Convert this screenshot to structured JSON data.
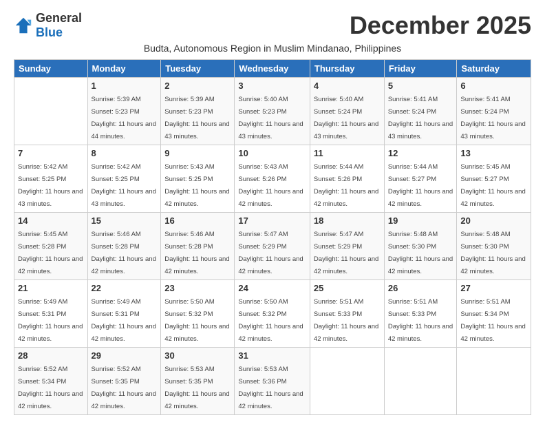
{
  "logo": {
    "general": "General",
    "blue": "Blue"
  },
  "title": "December 2025",
  "subtitle": "Budta, Autonomous Region in Muslim Mindanao, Philippines",
  "headers": [
    "Sunday",
    "Monday",
    "Tuesday",
    "Wednesday",
    "Thursday",
    "Friday",
    "Saturday"
  ],
  "weeks": [
    [
      {
        "day": "",
        "sunrise": "",
        "sunset": "",
        "daylight": ""
      },
      {
        "day": "1",
        "sunrise": "Sunrise: 5:39 AM",
        "sunset": "Sunset: 5:23 PM",
        "daylight": "Daylight: 11 hours and 44 minutes."
      },
      {
        "day": "2",
        "sunrise": "Sunrise: 5:39 AM",
        "sunset": "Sunset: 5:23 PM",
        "daylight": "Daylight: 11 hours and 43 minutes."
      },
      {
        "day": "3",
        "sunrise": "Sunrise: 5:40 AM",
        "sunset": "Sunset: 5:23 PM",
        "daylight": "Daylight: 11 hours and 43 minutes."
      },
      {
        "day": "4",
        "sunrise": "Sunrise: 5:40 AM",
        "sunset": "Sunset: 5:24 PM",
        "daylight": "Daylight: 11 hours and 43 minutes."
      },
      {
        "day": "5",
        "sunrise": "Sunrise: 5:41 AM",
        "sunset": "Sunset: 5:24 PM",
        "daylight": "Daylight: 11 hours and 43 minutes."
      },
      {
        "day": "6",
        "sunrise": "Sunrise: 5:41 AM",
        "sunset": "Sunset: 5:24 PM",
        "daylight": "Daylight: 11 hours and 43 minutes."
      }
    ],
    [
      {
        "day": "7",
        "sunrise": "Sunrise: 5:42 AM",
        "sunset": "Sunset: 5:25 PM",
        "daylight": "Daylight: 11 hours and 43 minutes."
      },
      {
        "day": "8",
        "sunrise": "Sunrise: 5:42 AM",
        "sunset": "Sunset: 5:25 PM",
        "daylight": "Daylight: 11 hours and 43 minutes."
      },
      {
        "day": "9",
        "sunrise": "Sunrise: 5:43 AM",
        "sunset": "Sunset: 5:25 PM",
        "daylight": "Daylight: 11 hours and 42 minutes."
      },
      {
        "day": "10",
        "sunrise": "Sunrise: 5:43 AM",
        "sunset": "Sunset: 5:26 PM",
        "daylight": "Daylight: 11 hours and 42 minutes."
      },
      {
        "day": "11",
        "sunrise": "Sunrise: 5:44 AM",
        "sunset": "Sunset: 5:26 PM",
        "daylight": "Daylight: 11 hours and 42 minutes."
      },
      {
        "day": "12",
        "sunrise": "Sunrise: 5:44 AM",
        "sunset": "Sunset: 5:27 PM",
        "daylight": "Daylight: 11 hours and 42 minutes."
      },
      {
        "day": "13",
        "sunrise": "Sunrise: 5:45 AM",
        "sunset": "Sunset: 5:27 PM",
        "daylight": "Daylight: 11 hours and 42 minutes."
      }
    ],
    [
      {
        "day": "14",
        "sunrise": "Sunrise: 5:45 AM",
        "sunset": "Sunset: 5:28 PM",
        "daylight": "Daylight: 11 hours and 42 minutes."
      },
      {
        "day": "15",
        "sunrise": "Sunrise: 5:46 AM",
        "sunset": "Sunset: 5:28 PM",
        "daylight": "Daylight: 11 hours and 42 minutes."
      },
      {
        "day": "16",
        "sunrise": "Sunrise: 5:46 AM",
        "sunset": "Sunset: 5:28 PM",
        "daylight": "Daylight: 11 hours and 42 minutes."
      },
      {
        "day": "17",
        "sunrise": "Sunrise: 5:47 AM",
        "sunset": "Sunset: 5:29 PM",
        "daylight": "Daylight: 11 hours and 42 minutes."
      },
      {
        "day": "18",
        "sunrise": "Sunrise: 5:47 AM",
        "sunset": "Sunset: 5:29 PM",
        "daylight": "Daylight: 11 hours and 42 minutes."
      },
      {
        "day": "19",
        "sunrise": "Sunrise: 5:48 AM",
        "sunset": "Sunset: 5:30 PM",
        "daylight": "Daylight: 11 hours and 42 minutes."
      },
      {
        "day": "20",
        "sunrise": "Sunrise: 5:48 AM",
        "sunset": "Sunset: 5:30 PM",
        "daylight": "Daylight: 11 hours and 42 minutes."
      }
    ],
    [
      {
        "day": "21",
        "sunrise": "Sunrise: 5:49 AM",
        "sunset": "Sunset: 5:31 PM",
        "daylight": "Daylight: 11 hours and 42 minutes."
      },
      {
        "day": "22",
        "sunrise": "Sunrise: 5:49 AM",
        "sunset": "Sunset: 5:31 PM",
        "daylight": "Daylight: 11 hours and 42 minutes."
      },
      {
        "day": "23",
        "sunrise": "Sunrise: 5:50 AM",
        "sunset": "Sunset: 5:32 PM",
        "daylight": "Daylight: 11 hours and 42 minutes."
      },
      {
        "day": "24",
        "sunrise": "Sunrise: 5:50 AM",
        "sunset": "Sunset: 5:32 PM",
        "daylight": "Daylight: 11 hours and 42 minutes."
      },
      {
        "day": "25",
        "sunrise": "Sunrise: 5:51 AM",
        "sunset": "Sunset: 5:33 PM",
        "daylight": "Daylight: 11 hours and 42 minutes."
      },
      {
        "day": "26",
        "sunrise": "Sunrise: 5:51 AM",
        "sunset": "Sunset: 5:33 PM",
        "daylight": "Daylight: 11 hours and 42 minutes."
      },
      {
        "day": "27",
        "sunrise": "Sunrise: 5:51 AM",
        "sunset": "Sunset: 5:34 PM",
        "daylight": "Daylight: 11 hours and 42 minutes."
      }
    ],
    [
      {
        "day": "28",
        "sunrise": "Sunrise: 5:52 AM",
        "sunset": "Sunset: 5:34 PM",
        "daylight": "Daylight: 11 hours and 42 minutes."
      },
      {
        "day": "29",
        "sunrise": "Sunrise: 5:52 AM",
        "sunset": "Sunset: 5:35 PM",
        "daylight": "Daylight: 11 hours and 42 minutes."
      },
      {
        "day": "30",
        "sunrise": "Sunrise: 5:53 AM",
        "sunset": "Sunset: 5:35 PM",
        "daylight": "Daylight: 11 hours and 42 minutes."
      },
      {
        "day": "31",
        "sunrise": "Sunrise: 5:53 AM",
        "sunset": "Sunset: 5:36 PM",
        "daylight": "Daylight: 11 hours and 42 minutes."
      },
      {
        "day": "",
        "sunrise": "",
        "sunset": "",
        "daylight": ""
      },
      {
        "day": "",
        "sunrise": "",
        "sunset": "",
        "daylight": ""
      },
      {
        "day": "",
        "sunrise": "",
        "sunset": "",
        "daylight": ""
      }
    ]
  ]
}
